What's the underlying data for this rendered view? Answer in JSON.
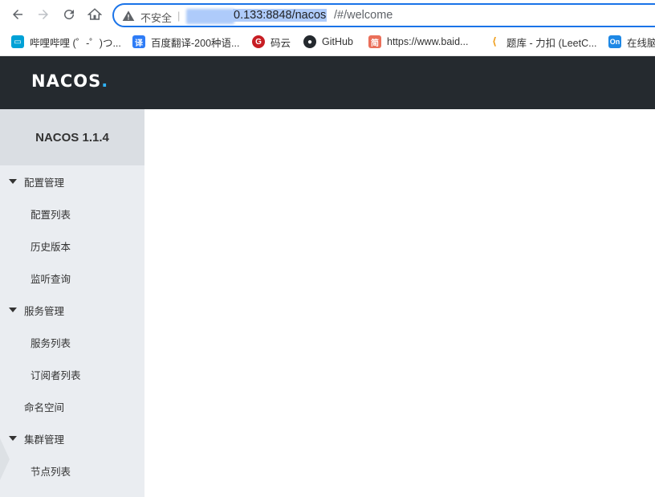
{
  "browser": {
    "security_label": "不安全",
    "separator": "|",
    "url_host_visible": "0.133:8848/nacos",
    "url_rest": "/#/welcome"
  },
  "bookmarks": [
    {
      "label": "哔哩哔哩 (゜-゜)つ...",
      "icon": "bilibili-icon",
      "color": "#00a1d6"
    },
    {
      "label": "百度翻译-200种语...",
      "icon": "translate-icon",
      "color": "#2e7cf6"
    },
    {
      "label": "码云",
      "icon": "gitee-icon",
      "color": "#c71d23"
    },
    {
      "label": "GitHub",
      "icon": "github-icon",
      "color": "#24292e"
    },
    {
      "label": "https://www.baid...",
      "icon": "jianshu-icon",
      "color": "#ea6f5a"
    },
    {
      "label": "题库 - 力扣 (LeetC...",
      "icon": "leetcode-icon",
      "color": "#f0a020"
    },
    {
      "label": "在线脑",
      "icon": "on-icon",
      "color": "#1e88e5"
    }
  ],
  "header": {
    "logo_text": "NACOS",
    "logo_dot": "."
  },
  "sidebar": {
    "version": "NACOS 1.1.4",
    "groups": [
      {
        "label": "配置管理",
        "items": [
          "配置列表",
          "历史版本",
          "监听查询"
        ]
      },
      {
        "label": "服务管理",
        "items": [
          "服务列表",
          "订阅者列表"
        ]
      },
      {
        "label": "命名空间",
        "items": []
      },
      {
        "label": "集群管理",
        "items": [
          "节点列表"
        ]
      }
    ]
  },
  "colors": {
    "header_bg": "#252a2f",
    "sidebar_bg": "#eaedf1",
    "accent": "#1a73e8",
    "logo_accent": "#2fb2f9"
  }
}
